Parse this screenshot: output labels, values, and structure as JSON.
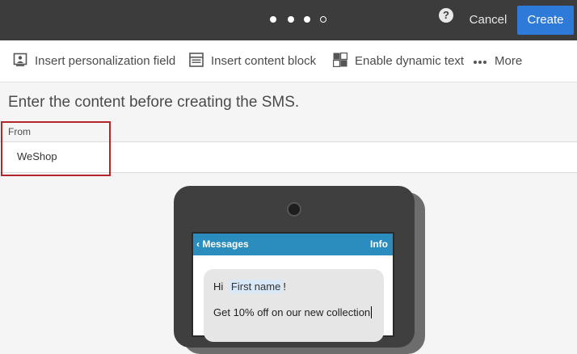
{
  "header": {
    "steps": [
      {
        "state": "filled"
      },
      {
        "state": "filled"
      },
      {
        "state": "filled"
      },
      {
        "state": "hollow"
      }
    ],
    "help_icon": "help-icon",
    "help_glyph": "?",
    "cancel_label": "Cancel",
    "create_label": "Create",
    "accent": "#2d7ad9"
  },
  "toolbar": {
    "items": [
      {
        "label": "Insert personalization field",
        "icon": "personalization-icon"
      },
      {
        "label": "Insert content block",
        "icon": "content-block-icon"
      },
      {
        "label": "Enable dynamic text",
        "icon": "dynamic-text-icon"
      },
      {
        "label": "More",
        "icon": "more-icon"
      }
    ]
  },
  "instructions": "Enter the content before creating the SMS.",
  "from": {
    "label": "From",
    "value": "WeShop",
    "highlight_color": "#b3262b"
  },
  "preview": {
    "back_label": "Messages",
    "info_label": "Info",
    "header_color": "#2b8cbe",
    "greeting": "Hi",
    "personalization_field": "First name",
    "exclamation": "!",
    "body": "Get 10% off on our new collection"
  }
}
